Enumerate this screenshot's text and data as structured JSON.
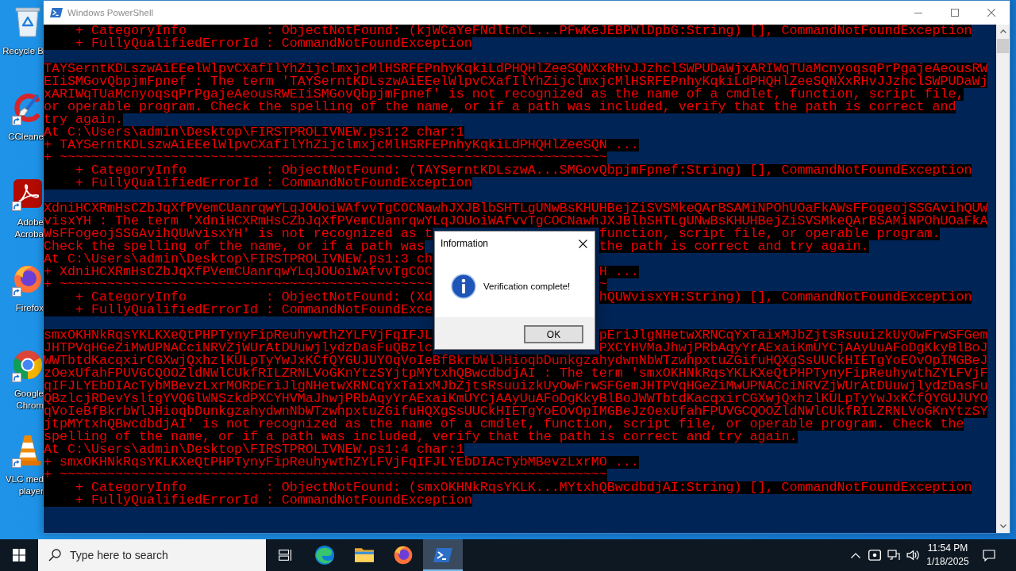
{
  "desktop": {
    "icons": [
      {
        "kind": "recycle-bin",
        "label": "Recycle B",
        "shortcut": false
      },
      {
        "kind": "ccleaner",
        "label": "CCleane",
        "shortcut": true
      },
      {
        "kind": "acrobat",
        "label": "Adobe Acroba",
        "shortcut": true
      },
      {
        "kind": "firefox",
        "label": "Firefox",
        "shortcut": true
      },
      {
        "kind": "chrome",
        "label": "Google Chrom",
        "shortcut": true
      },
      {
        "kind": "vlc",
        "label": "VLC med player",
        "shortcut": true
      }
    ]
  },
  "window": {
    "title": "Windows PowerShell",
    "active": false,
    "console": {
      "blocks": [
        [
          [
            "    + CategoryInfo          : ObjectNotFound: (kjWCaYeFNdltnCL...PFwKeJEBPWlDpbG:String) [], CommandNotFoundException"
          ],
          [
            "    + FullyQualifiedErrorId : CommandNotFoundException"
          ]
        ],
        [
          [
            "TAYSerntKDLszwAiEEelWlpvCXafIlYhZijclmxjcMlHSRFEPnhyKqkiLdPHQHlZeeSQNXxRHvJJzhclSWPUDaWjxARIWqTUaMcnyoqsqPrPgajeAeousRW"
          ],
          [
            "EIiSMGovQbpjmFpnef : The term 'TAYSerntKDLszwAiEEelWlpvCXafIlYhZijclmxjcMlHSRFEPnhyKqkiLdPHQHlZeeSQNXxRHvJJzhclSWPUDaWj"
          ],
          [
            "xARIWqTUaMcnyoqsqPrPgajeAeousRWEIiSMGovQbpjmFpnef' is not recognized as the name of a cmdlet, function, script file,"
          ],
          [
            "or operable program. Check the spelling of the name, or if a path was included, verify that the path is correct and"
          ],
          [
            "try again."
          ],
          [
            "At C:\\Users\\admin\\Desktop\\FIRSTPROLIVNEW.ps1:2 char:1"
          ],
          [
            "+ TAYSerntKDLszwAiEEelWlpvCXafIlYhZijclmxjcMlHSRFEPnhyKqkiLdPHQHlZeeSQN ..."
          ],
          [
            "+ ~~~~~~~~~~~~~~~~~~~~~~~~~~~~~~~~~~~~~~~~~~~~~~~~~~~~~~~~~~~~~~~~~~~~~"
          ],
          [
            "    + CategoryInfo          : ObjectNotFound: (TAYSerntKDLszwA...SMGovQbpjmFpnef:String) [], CommandNotFoundException"
          ],
          [
            "    + FullyQualifiedErrorId : CommandNotFoundException"
          ]
        ],
        [
          [
            "XdniHCXRmHsCZbJqXfPVemCUanrqwYLqJOUoiWAfvvTgCOCNawhJXJBlbSHTLgUNwBsKHUHBejZiSVSMkeQArBSAMiNPOhUOaFkAWsFFogeojSSGAvihQUW"
          ],
          [
            "visxYH : The term 'XdniHCXRmHsCZbJqXfPVemCUanrqwYLqJOUoiWAfvvTgCOCNawhJXJBlbSHTLgUNwBsKHUHBejZiSVSMkeQArBSAMiNPOhUOaFkA"
          ],
          [
            "WsFFogeojSSGAvihQUWvisxYH' is not recognized as t",
            "function, script file, or operable program."
          ],
          [
            "Check the spelling of the name, or if a path was",
            "the path is correct and try again."
          ],
          [
            "At C:\\Users\\admin\\Desktop\\FIRSTPROLIVNEW.ps1:3 ch"
          ],
          [
            "+ XdniHCXRmHsCZbJqXfPVemCUanrqwYLqJOUoiWAfvvTgCOC",
            "H ..."
          ],
          [
            "+ ~~~~~~~~~~~~~~~~~~~~~~~~~~~~~~~~~~~~~~~~~~~~~~~",
            "~"
          ],
          [
            "    + CategoryInfo          : ObjectNotFound: (Xd",
            "hQUWvisxYH:String) [], CommandNotFoundException"
          ],
          [
            "    + FullyQualifiedErrorId : CommandNotFoundExce"
          ]
        ],
        [
          [
            "smxOKHNkRqsYKLKXeQtPHPTynyFipReuhywthZYLFVjFqIFJL",
            "pEriJlgNHetwXRNCqYxTaixMJbZjtsRsuuizkUyOwFrwSFGem"
          ],
          [
            "JHTPVqHGeZiMwUPNACciNRVZjWUrAtDUuwjlydzDasFuQBzlc",
            "PXCYHVMaJhwjPRbAqyYrAExaiKmUYCjAAyUuAFoDgKkyBlBoJ"
          ],
          [
            "WWTbtdKacqxirCGXwjQxhzlKULpTyYwJxKCfQYGUJUYOqVoIeBfBkrbWlJHioqbDunkgzahydwnNbWTzwhpxtuZGifuHQXgSsUUCkHIETgYoEOvOpIMGBeJ"
          ],
          [
            "zOexUfahFPUVGCQOOZldNWlCUkfRILZRNLVoGKnYtzSYjtpMYtxhQBwcdbdjAI : The term 'smxOKHNkRqsYKLKXeQtPHPTynyFipReuhywthZYLFVjF"
          ],
          [
            "qIFJLYEbDIAcTybMBevzLxrMORpEriJlgNHetwXRNCqYxTaixMJbZjtsRsuuizkUyOwFrwSFGemJHTPVqHGeZiMwUPNACciNRVZjWUrAtDUuwjlydzDasFu"
          ],
          [
            "QBzlcjRDevYsltgYVQGlWNSzkdPXCYHVMaJhwjPRbAqyYrAExaiKmUYCjAAyUuAFoDgKkyBlBoJWWTbtdKacqxirCGXwjQxhzlKULpTyYwJxKCfQYGUJUYO"
          ],
          [
            "qVoIeBfBkrbWlJHioqbDunkgzahydwnNbWTzwhpxtuZGifuHQXgSsUUCkHIETgYoEOvOpIMGBeJzOexUfahFPUVGCQOOZldNWlCUkfRILZRNLVoGKnYtzSY"
          ],
          [
            "jtpMYtxhQBwcdbdjAI' is not recognized as the name of a cmdlet, function, script file, or operable program. Check the"
          ],
          [
            "spelling of the name, or if a path was included, verify that the path is correct and try again."
          ],
          [
            "At C:\\Users\\admin\\Desktop\\FIRSTPROLIVNEW.ps1:4 char:1"
          ],
          [
            "+ smxOKHNkRqsYKLKXeQtPHPTynyFipReuhywthZYLFVjFqIFJLYEbDIAcTybMBevzLxrMO ..."
          ],
          [
            "+ ~~~~~~~~~~~~~~~~~~~~~~~~~~~~~~~~~~~~~~~~~~~~~~~~~~~~~~~~~~~~~~~~~~~~~"
          ],
          [
            "    + CategoryInfo          : ObjectNotFound: (smxOKHNkRqsYKLK...MYtxhQBwcdbdjAI:String) [], CommandNotFoundException"
          ],
          [
            "    + FullyQualifiedErrorId : CommandNotFoundException"
          ]
        ]
      ]
    }
  },
  "dialog": {
    "title": "Information",
    "message": "Verification complete!",
    "buttons": [
      "OK"
    ]
  },
  "taskbar": {
    "search": {
      "placeholder": "Type here to search"
    },
    "apps": [
      {
        "kind": "task-view",
        "selected": false
      },
      {
        "kind": "edge",
        "selected": false
      },
      {
        "kind": "file-explorer",
        "selected": false
      },
      {
        "kind": "firefox",
        "selected": false
      },
      {
        "kind": "powershell",
        "selected": true
      }
    ],
    "clock": {
      "time": "11:54 PM",
      "date": "1/18/2025"
    }
  }
}
